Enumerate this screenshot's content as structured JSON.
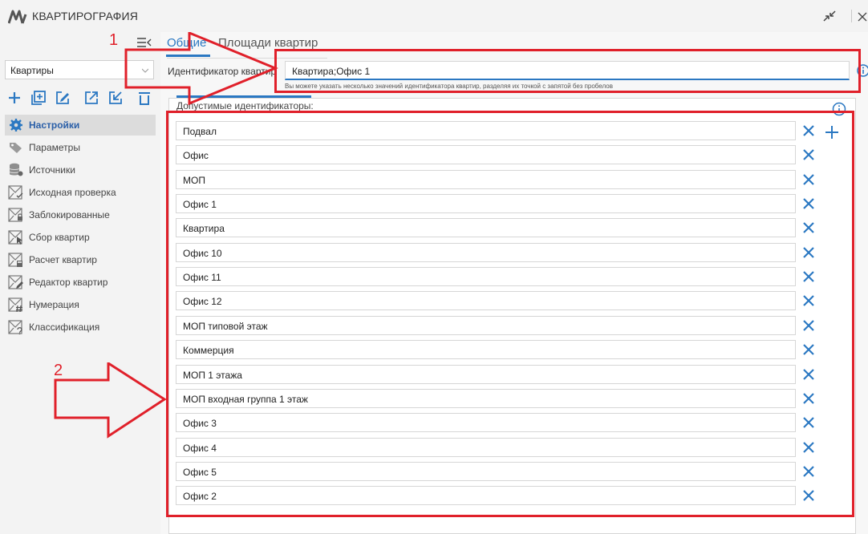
{
  "window": {
    "title": "КВАРТИРОГРАФИЯ"
  },
  "sidebar": {
    "dropdown_value": "Квартиры",
    "toolbar_icons": [
      "add-icon",
      "add-group-icon",
      "edit-icon",
      "export-icon",
      "import-icon",
      "delete-icon"
    ],
    "items": [
      {
        "label": "Настройки",
        "icon": "gear-icon",
        "active": true
      },
      {
        "label": "Параметры",
        "icon": "tags-icon",
        "active": false
      },
      {
        "label": "Источники",
        "icon": "database-gear-icon",
        "active": false
      },
      {
        "label": "Исходная проверка",
        "icon": "envelope-check-icon",
        "active": false
      },
      {
        "label": "Заблокированные",
        "icon": "envelope-lock-icon",
        "active": false
      },
      {
        "label": "Сбор квартир",
        "icon": "envelope-cursor-icon",
        "active": false
      },
      {
        "label": "Расчет квартир",
        "icon": "envelope-calc-icon",
        "active": false
      },
      {
        "label": "Редактор квартир",
        "icon": "envelope-edit-icon",
        "active": false
      },
      {
        "label": "Нумерация",
        "icon": "envelope-hash-icon",
        "active": false
      },
      {
        "label": "Классификация",
        "icon": "envelope-question-icon",
        "active": false
      }
    ]
  },
  "tabs": [
    {
      "label": "Общие",
      "active": true
    },
    {
      "label": "Площади квартир",
      "active": false
    }
  ],
  "identifier": {
    "label": "Идентификатор квартир",
    "value": "Квартира;Офис 1",
    "hint": "Вы можете указать несколько значений идентификатора квартир, разделяя их точкой с запятой без пробелов"
  },
  "allowed": {
    "label": "Допустимые идентификаторы:",
    "items": [
      "Подвал",
      "Офис",
      "МОП",
      "Офис 1",
      "Квартира",
      "Офис 10",
      "Офис 11",
      "Офис 12",
      "МОП типовой этаж",
      "Коммерция",
      "МОП 1 этажа",
      "МОП входная группа 1 этаж",
      "Офис 3",
      "Офис 4",
      "Офис 5",
      "Офис 2"
    ]
  },
  "annotations": {
    "label_1": "1",
    "label_2": "2"
  },
  "colors": {
    "accent": "#2b78c2",
    "annotation": "#e0202a"
  }
}
